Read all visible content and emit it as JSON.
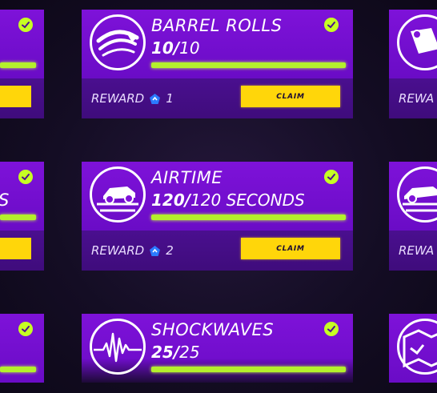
{
  "challenges": [
    {
      "title": "BARREL ROLLS",
      "progress_current": "10/",
      "progress_total": "10",
      "progress_fraction": 1.0,
      "completed": true,
      "reward_label": "REWARD",
      "reward_amount": "1",
      "claim_label": "CLAIM",
      "icon": "barrel-roll-icon"
    },
    {
      "title": "AIRTIME",
      "progress_current": "120/",
      "progress_total": "120 SECONDS",
      "progress_fraction": 1.0,
      "completed": true,
      "reward_label": "REWARD",
      "reward_amount": "2",
      "claim_label": "CLAIM",
      "icon": "car-airtime-icon"
    },
    {
      "title": "SHOCKWAVES",
      "progress_current": "25/",
      "progress_total": "25",
      "progress_fraction": 1.0,
      "completed": true,
      "icon": "shockwave-icon"
    }
  ],
  "left_column": {
    "middle_title_fragment": "S"
  },
  "right_column": {
    "reward_fragment_top": "REWA",
    "reward_fragment_middle": "REWA"
  },
  "colors": {
    "card_purple": "#7e12d9",
    "card_bottom": "#4a0f8f",
    "progress_green": "#b4f02c",
    "check_green": "#c6ff23",
    "claim_yellow": "#ffd60a",
    "gem_blue": "#2b7bff"
  }
}
